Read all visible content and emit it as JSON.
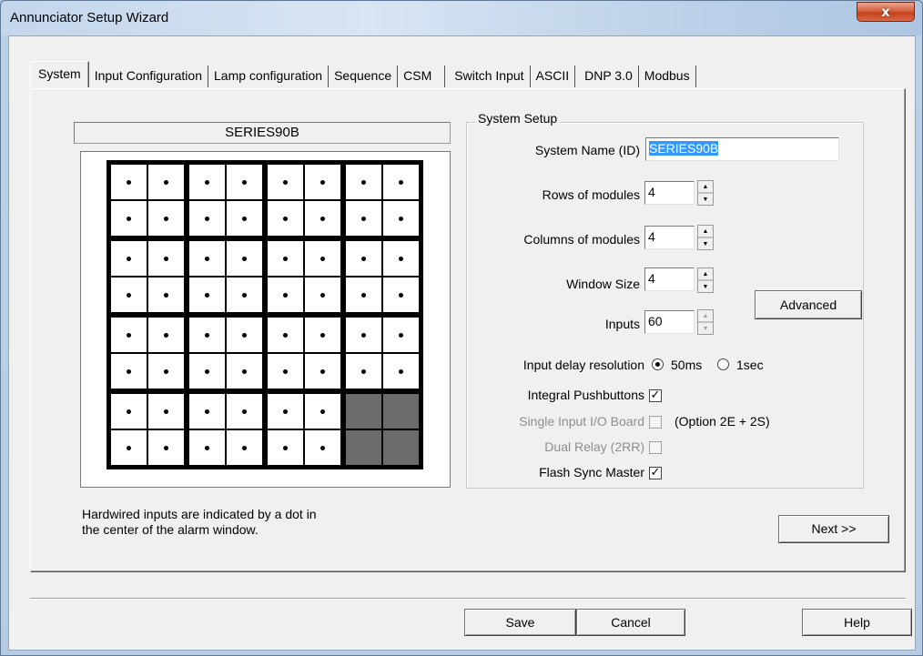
{
  "window": {
    "title": "Annunciator Setup Wizard",
    "close_glyph": "x"
  },
  "tabs": [
    {
      "label": "System",
      "active": true
    },
    {
      "label": "Input Configuration"
    },
    {
      "label": "Lamp configuration"
    },
    {
      "label": "Sequence"
    },
    {
      "label": "CSM"
    },
    {
      "label": "Switch Input"
    },
    {
      "label": "ASCII"
    },
    {
      "label": "DNP 3.0"
    },
    {
      "label": "Modbus"
    }
  ],
  "preview": {
    "name": "SERIES90B",
    "rows_of_windows": 8,
    "cols_of_windows": 8,
    "inactive_cells": [
      "6-6",
      "6-7",
      "7-6",
      "7-7"
    ],
    "note_line1": "Hardwired inputs are indicated by a dot in",
    "note_line2": "the center of the alarm window."
  },
  "system_setup": {
    "legend": "System Setup",
    "system_name_label": "System Name (ID)",
    "system_name_value": "SERIES90B",
    "rows_label": "Rows of modules",
    "rows_value": "4",
    "cols_label": "Columns of modules",
    "cols_value": "4",
    "window_size_label": "Window Size",
    "window_size_value": "4",
    "inputs_label": "Inputs",
    "inputs_value": "60",
    "advanced_label": "Advanced",
    "input_delay_label": "Input delay resolution",
    "delay_opt1": "50ms",
    "delay_opt2": "1sec",
    "delay_selected": "50ms",
    "integral_pb_label": "Integral Pushbuttons",
    "integral_pb_checked": true,
    "single_input_label": "Single Input I/O Board",
    "single_input_note": "(Option 2E + 2S)",
    "single_input_checked": false,
    "dual_relay_label": "Dual Relay (2RR)",
    "dual_relay_checked": false,
    "flash_sync_label": "Flash Sync Master",
    "flash_sync_checked": true
  },
  "buttons": {
    "next": "Next >>",
    "save": "Save",
    "cancel": "Cancel",
    "help": "Help"
  },
  "icons": {
    "close": "close-icon",
    "spin_up": "spin-up-arrow-icon",
    "spin_down": "spin-down-arrow-icon",
    "check": "checkmark-icon"
  }
}
